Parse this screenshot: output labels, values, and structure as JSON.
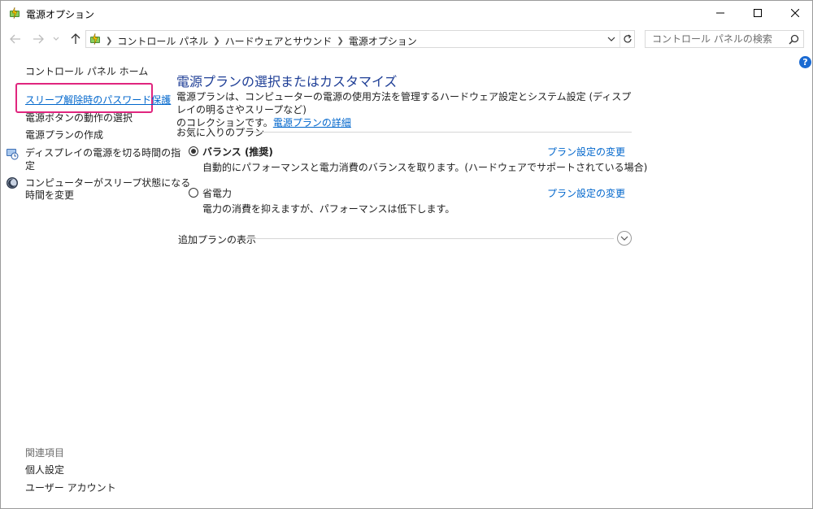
{
  "window": {
    "title": "電源オプション",
    "controls": [
      "minimize-icon",
      "maximize-icon",
      "close-icon"
    ]
  },
  "navigation": {
    "breadcrumbs": [
      "コントロール パネル",
      "ハードウェアとサウンド",
      "電源オプション"
    ],
    "search_placeholder": "コントロール パネルの検索",
    "icons": [
      "back-arrow-icon",
      "forward-arrow-icon",
      "recent-dropdown-icon",
      "up-arrow-icon",
      "dropdown-icon",
      "refresh-icon",
      "search-icon",
      "help-icon"
    ]
  },
  "left_pane": {
    "home": "コントロール パネル ホーム",
    "tasks": [
      "スリープ解除時のパスワード保護",
      "電源ボタンの動作の選択",
      "電源プランの作成",
      "ディスプレイの電源を切る時間の指定",
      "コンピューターがスリープ状態になる時間を変更"
    ],
    "task_lines": {
      "display_1": "ディスプレイの電源を切る時間の指",
      "display_2": "定",
      "sleep_1": "コンピューターがスリープ状態になる",
      "sleep_2": "時間を変更"
    },
    "related_heading": "関連項目",
    "related": [
      "個人設定",
      "ユーザー アカウント"
    ]
  },
  "main": {
    "title": "電源プランの選択またはカスタマイズ",
    "description_line1": "電源プランは、コンピューターの電源の使用方法を管理するハードウェア設定とシステム設定 (ディスプレイの明るさやスリープなど)",
    "description_line2": "のコレクションです。",
    "details_link": "電源プランの詳細",
    "favorites_heading": "お気に入りのプラン",
    "plans": [
      {
        "name": "バランス (推奨)",
        "description": "自動的にパフォーマンスと電力消費のバランスを取ります。(ハードウェアでサポートされている場合)",
        "selected": true,
        "link": "プラン設定の変更"
      },
      {
        "name": "省電力",
        "description": "電力の消費を抑えますが、パフォーマンスは低下します。",
        "selected": false,
        "link": "プラン設定の変更"
      }
    ],
    "more_plans_label": "追加プランの表示"
  },
  "colors": {
    "title_blue": "#1e3e96",
    "link_blue": "#0066cc",
    "highlight": "#e0257e"
  }
}
